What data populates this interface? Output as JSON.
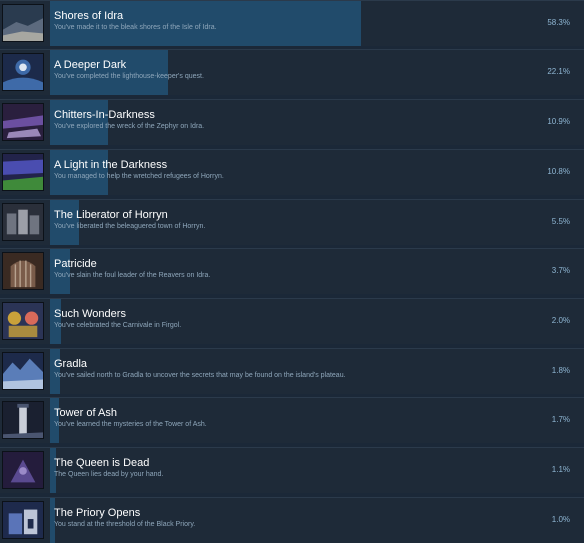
{
  "achievements": [
    {
      "title": "Shores of Idra",
      "description": "You've made it to the bleak shores of the Isle of Idra.",
      "percent_text": "58.3%",
      "percent": 58.3,
      "icon": "idra-shore-icon",
      "colors": [
        "#2a3b4f",
        "#5c6a7e",
        "#c8c2b0"
      ]
    },
    {
      "title": "A Deeper Dark",
      "description": "You've completed the lighthouse-keeper's quest.",
      "percent_text": "22.1%",
      "percent": 22.1,
      "icon": "lighthouse-icon",
      "colors": [
        "#1c2a4a",
        "#3e6aa8",
        "#dfe8f2"
      ]
    },
    {
      "title": "Chitters-In-Darkness",
      "description": "You've explored the wreck of the Zephyr on Idra.",
      "percent_text": "10.9%",
      "percent": 10.9,
      "icon": "shipwreck-icon",
      "colors": [
        "#2a1f3e",
        "#6b4fa0",
        "#b7a3d8"
      ]
    },
    {
      "title": "A Light in the Darkness",
      "description": "You managed to help the wretched refugees of Horryn.",
      "percent_text": "10.8%",
      "percent": 10.8,
      "icon": "refugees-icon",
      "colors": [
        "#22234a",
        "#4a4db0",
        "#3f8a3a"
      ]
    },
    {
      "title": "The Liberator of Horryn",
      "description": "You've liberated the beleaguered town of Horryn.",
      "percent_text": "5.5%",
      "percent": 5.5,
      "icon": "town-icon",
      "colors": [
        "#2a2f3a",
        "#6f7480",
        "#b9bcc4"
      ]
    },
    {
      "title": "Patricide",
      "description": "You've slain the foul leader of the Reavers on Idra.",
      "percent_text": "3.7%",
      "percent": 3.7,
      "icon": "gate-icon",
      "colors": [
        "#3a2a22",
        "#7a5c4a",
        "#b6a18e"
      ]
    },
    {
      "title": "Such Wonders",
      "description": "You've celebrated the Carnivale in Firgol.",
      "percent_text": "2.0%",
      "percent": 2.0,
      "icon": "carnivale-icon",
      "colors": [
        "#2b3456",
        "#c9a13a",
        "#d86a5a"
      ]
    },
    {
      "title": "Gradla",
      "description": "You've sailed north to Gradla to uncover the secrets that may be found on the island's plateau.",
      "percent_text": "1.8%",
      "percent": 1.8,
      "icon": "gradla-icon",
      "colors": [
        "#1d2a4a",
        "#5a7db8",
        "#d6e2ef"
      ]
    },
    {
      "title": "Tower of Ash",
      "description": "You've learned the mysteries of the Tower of Ash.",
      "percent_text": "1.7%",
      "percent": 1.7,
      "icon": "tower-icon",
      "colors": [
        "#1a2030",
        "#4a5570",
        "#c9ced8"
      ]
    },
    {
      "title": "The Queen is Dead",
      "description": "The Queen lies dead by your hand.",
      "percent_text": "1.1%",
      "percent": 1.1,
      "icon": "queen-icon",
      "colors": [
        "#241c3c",
        "#5a4a90",
        "#9a8ac8"
      ]
    },
    {
      "title": "The Priory Opens",
      "description": "You stand at the threshold of the Black Priory.",
      "percent_text": "1.0%",
      "percent": 1.0,
      "icon": "priory-icon",
      "colors": [
        "#1e2a4c",
        "#5a74b8",
        "#d8dff0"
      ]
    }
  ],
  "theme": {
    "background": "#1b2838",
    "bar": "#214b6b",
    "title": "#ffffff",
    "description": "#8fa7bb",
    "percent": "#8fb6d3"
  }
}
